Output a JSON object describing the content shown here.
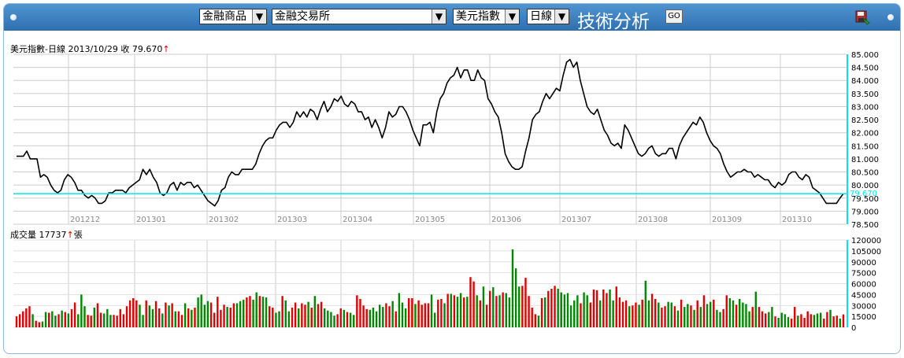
{
  "toolbar": {
    "category_select": "金融商品",
    "market_select": "金融交易所",
    "symbol_select": "美元指數",
    "period_select": "日線",
    "title": "技術分析",
    "go_label": "GO"
  },
  "price_panel": {
    "header_name": "美元指數-日線",
    "header_date": "2013/10/29",
    "header_close_label": "收",
    "header_close_value": "79.670",
    "header_arrow": "↑",
    "current_value_label": "79.670"
  },
  "volume_panel": {
    "header_name": "成交量",
    "header_value": "17737",
    "header_arrow": "↑",
    "header_unit": "張"
  },
  "colors": {
    "header_bg": "#3a7fc0",
    "price_line": "#000000",
    "current_line": "#00e5ee",
    "axis": "#00e5ee",
    "up_bar": "#e00000",
    "down_bar": "#008800",
    "grid": "#cccccc"
  },
  "chart_data": [
    {
      "type": "line",
      "title": "美元指數-日線",
      "x_tick_labels": [
        "201212",
        "201301",
        "201302",
        "201303",
        "201304",
        "201305",
        "201306",
        "201307",
        "201308",
        "201309",
        "201310"
      ],
      "y_tick_labels": [
        "85.000",
        "84.500",
        "84.000",
        "83.500",
        "83.000",
        "82.500",
        "82.000",
        "81.500",
        "81.000",
        "80.500",
        "80.000",
        "79.500",
        "79.000",
        "78.500"
      ],
      "ylim": [
        78.5,
        85.0
      ],
      "reference_value": 79.67,
      "grid": true,
      "values": [
        81.1,
        81.1,
        81.1,
        81.3,
        81.0,
        81.0,
        81.0,
        80.3,
        80.4,
        80.3,
        80.0,
        79.8,
        79.7,
        79.8,
        80.2,
        80.4,
        80.3,
        80.1,
        79.8,
        79.8,
        79.6,
        79.5,
        79.6,
        79.5,
        79.3,
        79.3,
        79.4,
        79.7,
        79.7,
        79.8,
        79.8,
        79.8,
        79.7,
        79.9,
        80.0,
        80.1,
        80.2,
        80.6,
        80.4,
        80.6,
        80.3,
        80.1,
        79.7,
        79.6,
        79.7,
        80.0,
        80.1,
        79.8,
        80.1,
        80.0,
        80.1,
        80.1,
        79.9,
        80.0,
        79.8,
        79.6,
        79.4,
        79.3,
        79.2,
        79.4,
        79.8,
        79.9,
        80.3,
        80.5,
        80.4,
        80.4,
        80.6,
        80.6,
        80.6,
        80.6,
        80.8,
        81.2,
        81.5,
        81.7,
        81.8,
        81.8,
        82.1,
        82.3,
        82.4,
        82.4,
        82.2,
        82.4,
        82.8,
        82.6,
        82.8,
        82.6,
        82.9,
        82.8,
        82.5,
        82.9,
        83.2,
        82.8,
        83.0,
        83.3,
        83.2,
        83.4,
        83.1,
        83.0,
        83.2,
        83.1,
        82.8,
        82.8,
        82.5,
        82.6,
        82.2,
        82.5,
        82.2,
        81.8,
        82.2,
        82.8,
        82.6,
        82.7,
        83.0,
        83.0,
        82.8,
        82.5,
        82.1,
        81.8,
        81.5,
        82.3,
        82.3,
        82.4,
        82.0,
        82.8,
        83.3,
        83.5,
        83.9,
        84.1,
        84.2,
        84.5,
        84.1,
        84.4,
        84.4,
        84.0,
        84.0,
        84.4,
        84.1,
        84.0,
        83.3,
        83.1,
        82.8,
        82.6,
        82.0,
        81.2,
        80.9,
        80.7,
        80.6,
        80.6,
        80.7,
        81.3,
        81.8,
        82.5,
        82.7,
        82.8,
        83.2,
        83.5,
        83.3,
        83.5,
        83.7,
        83.6,
        84.2,
        84.7,
        84.8,
        84.5,
        84.7,
        84.0,
        83.5,
        83.0,
        82.8,
        82.7,
        82.9,
        82.5,
        82.1,
        81.9,
        81.6,
        81.5,
        81.6,
        81.4,
        82.3,
        82.1,
        81.8,
        81.5,
        81.2,
        81.1,
        81.2,
        81.4,
        81.5,
        81.2,
        81.1,
        81.2,
        81.2,
        81.4,
        81.4,
        81.0,
        81.5,
        81.8,
        82.0,
        82.2,
        82.4,
        82.3,
        82.6,
        82.4,
        82.0,
        81.7,
        81.5,
        81.4,
        81.2,
        80.8,
        80.5,
        80.3,
        80.4,
        80.5,
        80.5,
        80.6,
        80.5,
        80.5,
        80.3,
        80.4,
        80.3,
        80.2,
        80.2,
        80.0,
        79.9,
        80.1,
        80.0,
        80.1,
        80.4,
        80.5,
        80.5,
        80.3,
        80.2,
        80.4,
        80.3,
        79.9,
        79.8,
        79.7,
        79.5,
        79.3,
        79.3,
        79.3,
        79.3,
        79.5,
        79.67
      ]
    },
    {
      "type": "bar",
      "title": "成交量",
      "y_tick_labels": [
        "120000",
        "105000",
        "90000",
        "75000",
        "60000",
        "45000",
        "30000",
        "15000",
        "0"
      ],
      "ylim": [
        0,
        120000
      ],
      "grid": true,
      "values": [
        15000,
        18000,
        22000,
        26000,
        29000,
        18000,
        9000,
        7000,
        8000,
        21000,
        20000,
        22000,
        16000,
        18000,
        23000,
        21000,
        19000,
        25000,
        34000,
        18000,
        45000,
        29000,
        17000,
        16000,
        27000,
        33000,
        20000,
        19000,
        25000,
        17000,
        17000,
        16000,
        25000,
        18000,
        29000,
        37000,
        40000,
        37000,
        31000,
        17000,
        37000,
        30000,
        25000,
        36000,
        26000,
        19000,
        34000,
        30000,
        33000,
        22000,
        22000,
        17000,
        33000,
        26000,
        24000,
        27000,
        41000,
        45000,
        31000,
        36000,
        34000,
        20000,
        42000,
        24000,
        31000,
        28000,
        27000,
        33000,
        33000,
        36000,
        38000,
        41000,
        43000,
        38000,
        48000,
        43000,
        42000,
        41000,
        29000,
        27000,
        20000,
        22000,
        43000,
        37000,
        22000,
        27000,
        34000,
        26000,
        33000,
        31000,
        35000,
        27000,
        43000,
        32000,
        35000,
        26000,
        23000,
        21000,
        16000,
        18000,
        26000,
        24000,
        21000,
        20000,
        17000,
        44000,
        39000,
        30000,
        25000,
        24000,
        27000,
        22000,
        31000,
        28000,
        33000,
        29000,
        36000,
        22000,
        47000,
        34000,
        26000,
        40000,
        40000,
        32000,
        37000,
        31000,
        33000,
        33000,
        45000,
        20000,
        38000,
        39000,
        33000,
        46000,
        46000,
        44000,
        42000,
        47000,
        41000,
        42000,
        69000,
        63000,
        44000,
        37000,
        56000,
        31000,
        50000,
        55000,
        43000,
        44000,
        48000,
        47000,
        41000,
        107000,
        81000,
        56000,
        57000,
        68000,
        43000,
        27000,
        18000,
        16000,
        40000,
        41000,
        50000,
        53000,
        57000,
        53000,
        48000,
        45000,
        47000,
        30000,
        37000,
        44000,
        33000,
        48000,
        44000,
        34000,
        52000,
        51000,
        37000,
        52000,
        47000,
        52000,
        37000,
        56000,
        41000,
        35000,
        37000,
        29000,
        30000,
        34000,
        31000,
        38000,
        64000,
        37000,
        46000,
        39000,
        34000,
        27000,
        29000,
        35000,
        34000,
        29000,
        23000,
        38000,
        28000,
        32000,
        30000,
        24000,
        37000,
        28000,
        44000,
        32000,
        35000,
        38000,
        24000,
        21000,
        25000,
        44000,
        40000,
        37000,
        31000,
        39000,
        34000,
        32000,
        22000,
        28000,
        49000,
        28000,
        22000,
        19000,
        21000,
        28000,
        15000,
        13000,
        20000,
        18000,
        14000,
        12000,
        28000,
        16000,
        18000,
        13000,
        22000,
        18000,
        17000,
        19000,
        20000,
        12000,
        21000,
        24000,
        15000,
        16000,
        12000,
        17737
      ],
      "up": [
        1,
        1,
        1,
        1,
        1,
        0,
        1,
        1,
        0,
        0,
        1,
        0,
        0,
        1,
        0,
        1,
        0,
        1,
        1,
        0,
        0,
        0,
        1,
        1,
        0,
        1,
        1,
        0,
        0,
        0,
        1,
        1,
        1,
        1,
        1,
        1,
        1,
        1,
        0,
        0,
        1,
        0,
        0,
        1,
        1,
        0,
        1,
        0,
        1,
        0,
        1,
        1,
        0,
        1,
        0,
        1,
        0,
        0,
        0,
        0,
        1,
        1,
        1,
        1,
        1,
        0,
        1,
        1,
        0,
        0,
        0,
        1,
        1,
        0,
        0,
        1,
        0,
        0,
        1,
        1,
        0,
        0,
        1,
        0,
        0,
        1,
        1,
        0,
        1,
        1,
        0,
        1,
        0,
        1,
        1,
        0,
        0,
        0,
        0,
        1,
        1,
        0,
        1,
        0,
        0,
        1,
        1,
        1,
        1,
        0,
        0,
        0,
        0,
        0,
        1,
        1,
        0,
        1,
        0,
        0,
        0,
        1,
        1,
        0,
        1,
        1,
        1,
        1,
        0,
        0,
        1,
        1,
        0,
        1,
        0,
        1,
        0,
        0,
        1,
        0,
        1,
        1,
        0,
        1,
        0,
        1,
        1,
        0,
        1,
        0,
        1,
        0,
        0,
        0,
        0,
        0,
        1,
        1,
        1,
        1,
        1,
        0,
        1,
        0,
        1,
        1,
        1,
        0,
        0,
        0,
        0,
        0,
        0,
        0,
        1,
        0,
        0,
        1,
        1,
        1,
        0,
        1,
        1,
        0,
        0,
        1,
        1,
        1,
        1,
        0,
        1,
        1,
        0,
        1,
        0,
        0,
        1,
        1,
        0,
        1,
        1,
        0,
        0,
        1,
        0,
        1,
        0,
        0,
        1,
        0,
        1,
        0,
        1,
        0,
        0,
        1,
        0,
        0,
        1,
        1,
        0,
        0,
        1,
        0,
        0,
        0,
        0,
        1,
        0,
        1,
        1,
        1,
        0,
        0,
        1,
        0,
        0,
        0,
        0,
        1,
        1,
        0,
        1,
        1,
        1,
        1,
        0,
        0,
        0,
        1,
        1,
        0,
        1,
        1,
        0,
        1,
        0,
        0,
        0,
        1,
        1,
        1
      ]
    }
  ]
}
